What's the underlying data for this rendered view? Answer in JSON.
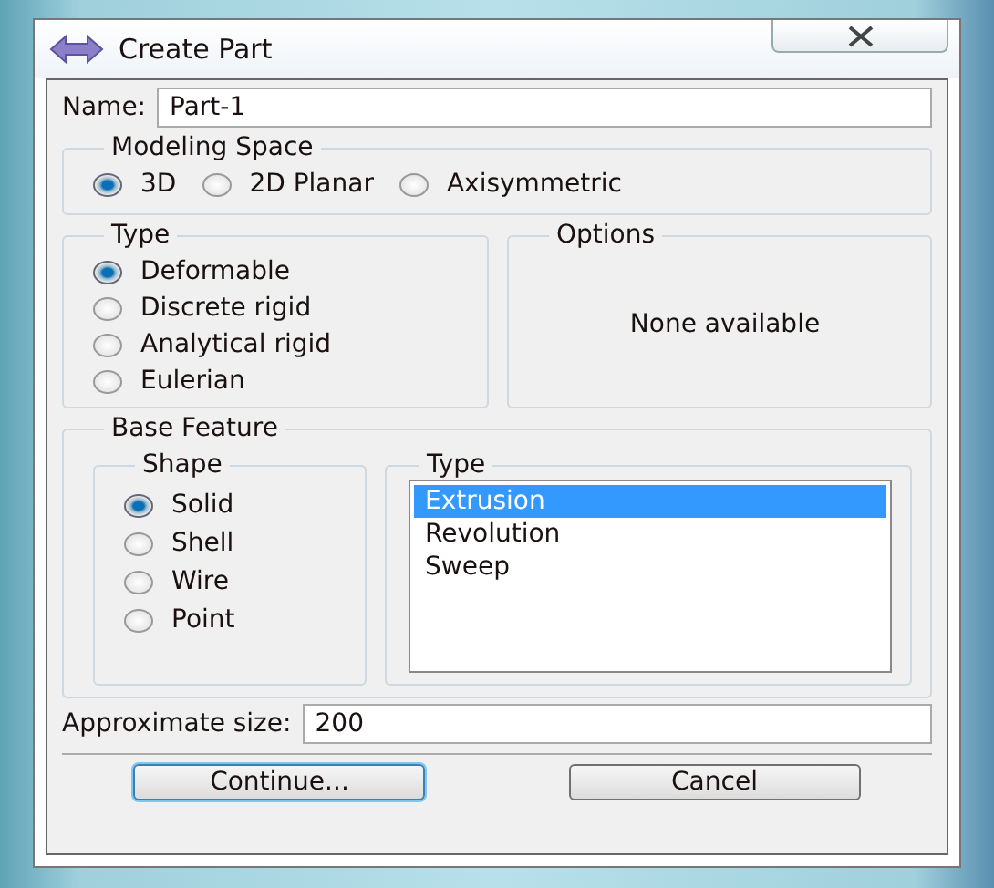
{
  "window": {
    "title": "Create Part"
  },
  "name": {
    "label": "Name:",
    "value": "Part-1"
  },
  "modeling_space": {
    "title": "Modeling Space",
    "options": [
      {
        "label": "3D",
        "selected": true
      },
      {
        "label": "2D Planar",
        "selected": false
      },
      {
        "label": "Axisymmetric",
        "selected": false
      }
    ]
  },
  "type": {
    "title": "Type",
    "options": [
      {
        "label": "Deformable",
        "selected": true
      },
      {
        "label": "Discrete rigid",
        "selected": false
      },
      {
        "label": "Analytical rigid",
        "selected": false
      },
      {
        "label": "Eulerian",
        "selected": false
      }
    ]
  },
  "options": {
    "title": "Options",
    "text": "None available"
  },
  "base_feature": {
    "title": "Base Feature",
    "shape": {
      "title": "Shape",
      "options": [
        {
          "label": "Solid",
          "selected": true
        },
        {
          "label": "Shell",
          "selected": false
        },
        {
          "label": "Wire",
          "selected": false
        },
        {
          "label": "Point",
          "selected": false
        }
      ]
    },
    "type": {
      "title": "Type",
      "items": [
        {
          "label": "Extrusion",
          "selected": true
        },
        {
          "label": "Revolution",
          "selected": false
        },
        {
          "label": "Sweep",
          "selected": false
        }
      ]
    }
  },
  "approximate_size": {
    "label": "Approximate size:",
    "value": "200"
  },
  "buttons": [
    {
      "label": "Continue...",
      "default": true
    },
    {
      "label": "Cancel",
      "default": false
    }
  ]
}
